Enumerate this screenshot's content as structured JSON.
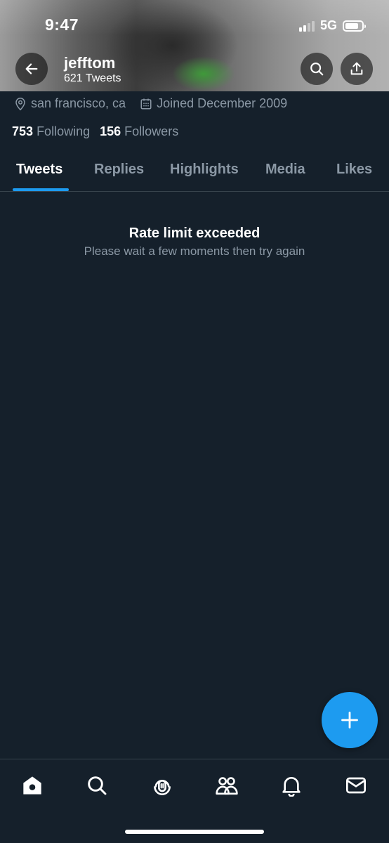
{
  "status_bar": {
    "time": "9:47",
    "network": "5G"
  },
  "header": {
    "name": "jefftom",
    "tweet_count": "621 Tweets"
  },
  "profile": {
    "location": "san francisco, ca",
    "joined": "Joined December 2009",
    "following_count": "753",
    "following_label": "Following",
    "followers_count": "156",
    "followers_label": "Followers"
  },
  "tabs": [
    {
      "label": "Tweets",
      "active": true
    },
    {
      "label": "Replies",
      "active": false
    },
    {
      "label": "Highlights",
      "active": false
    },
    {
      "label": "Media",
      "active": false
    },
    {
      "label": "Likes",
      "active": false
    }
  ],
  "empty_state": {
    "title": "Rate limit exceeded",
    "subtitle": "Please wait a few moments then try again"
  },
  "bottom_nav": [
    {
      "icon": "home-icon",
      "active": true
    },
    {
      "icon": "search-icon",
      "active": false
    },
    {
      "icon": "spaces-icon",
      "active": false
    },
    {
      "icon": "communities-icon",
      "active": false
    },
    {
      "icon": "notifications-icon",
      "active": false
    },
    {
      "icon": "messages-icon",
      "active": false
    }
  ],
  "colors": {
    "background": "#15202b",
    "accent": "#1d9bf0",
    "secondary_text": "#8b98a5",
    "divider": "#38444d"
  }
}
